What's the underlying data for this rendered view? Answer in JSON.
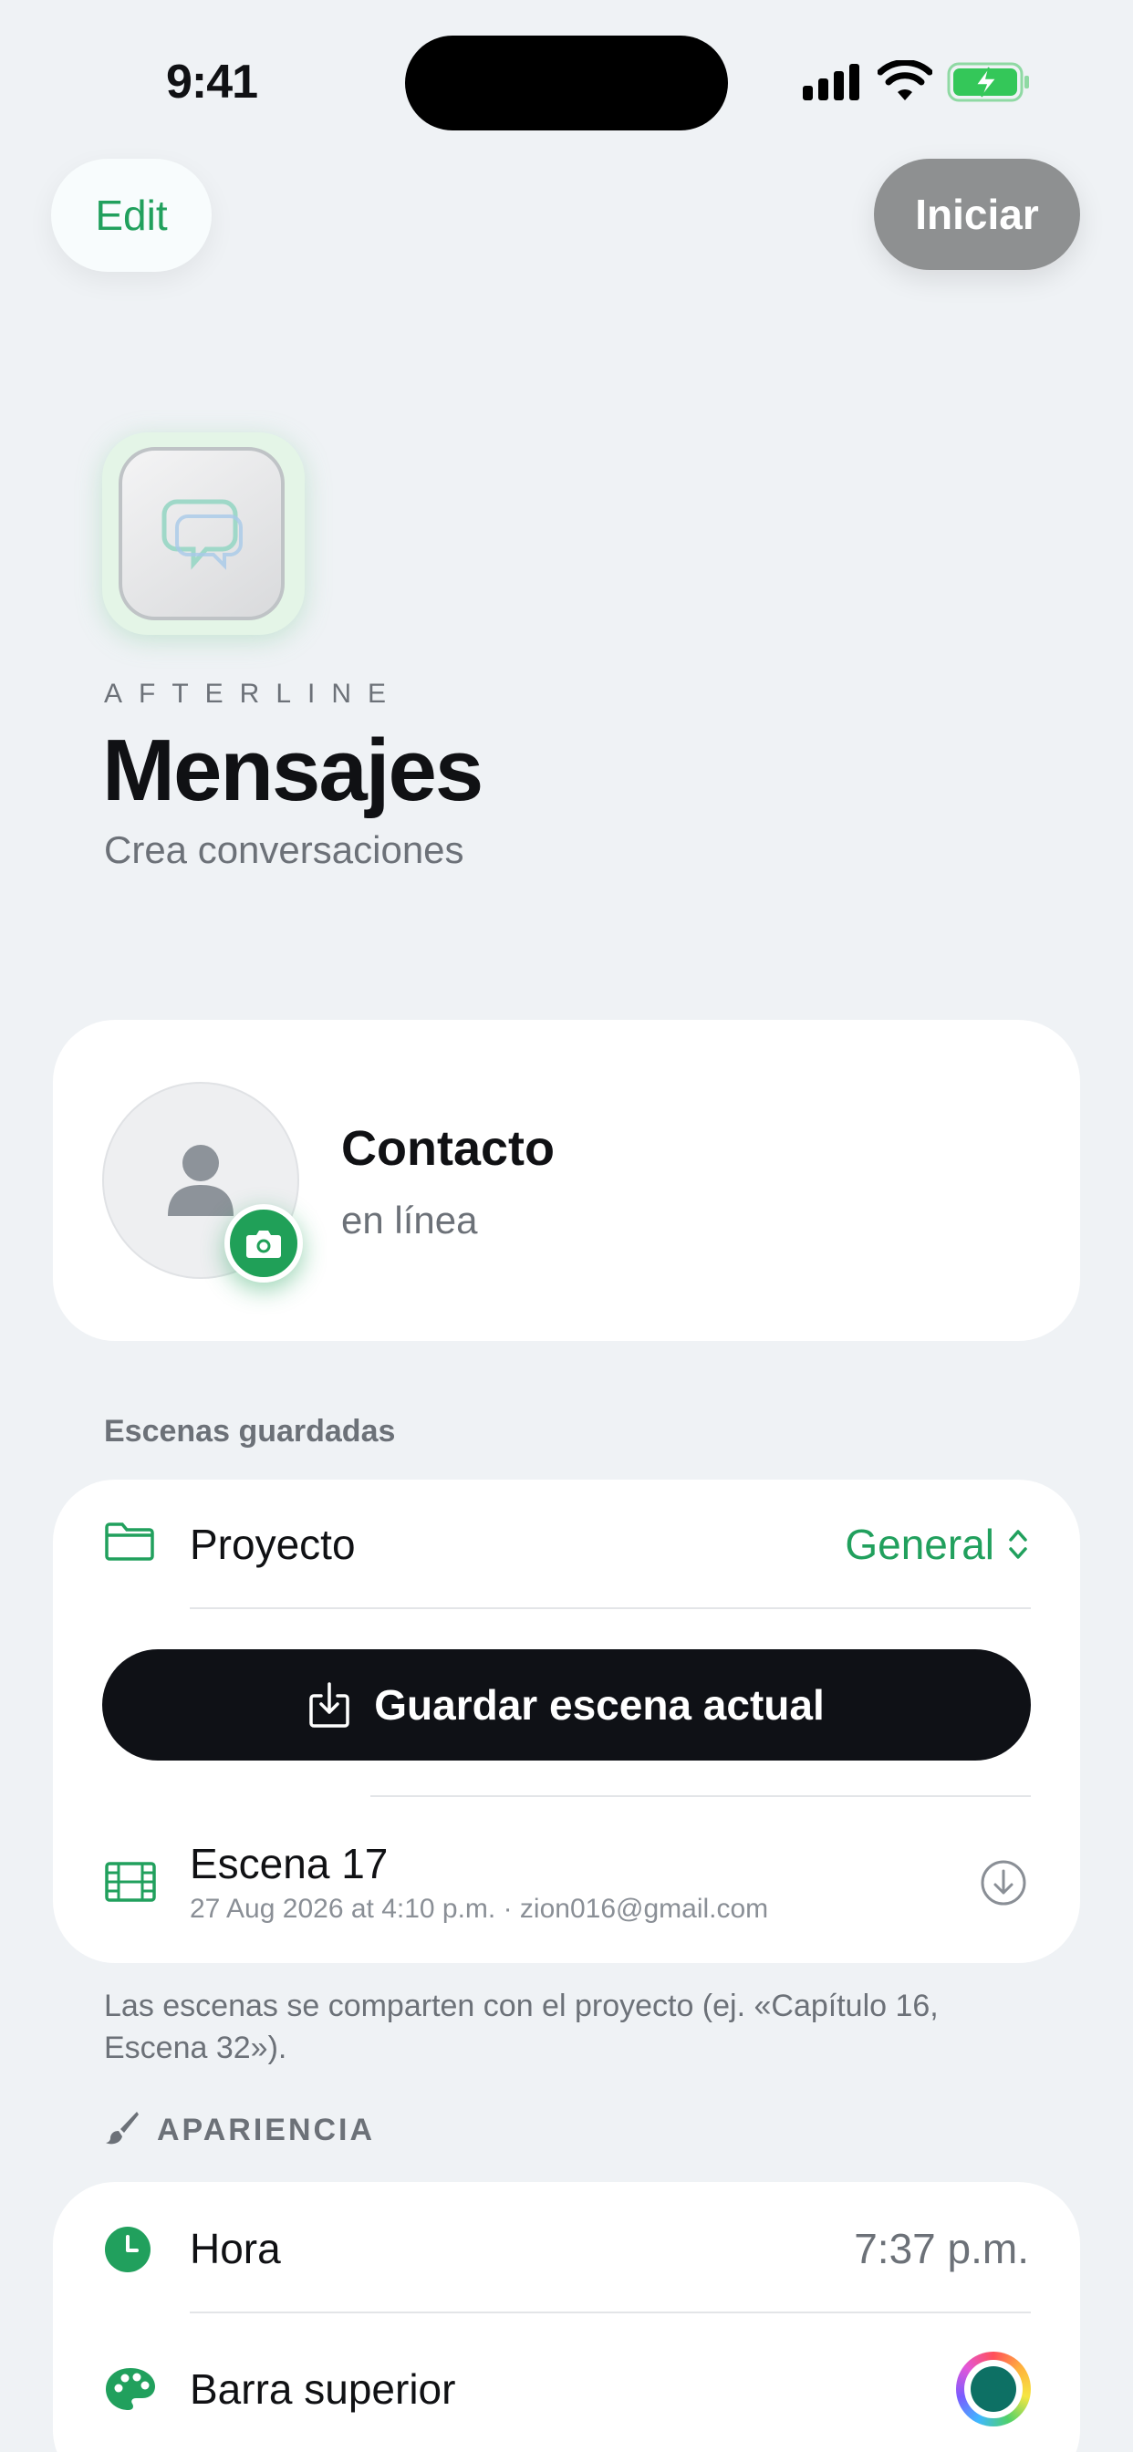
{
  "status_bar": {
    "time": "9:41",
    "icons": [
      "cellular-signal-icon",
      "wifi-icon",
      "battery-charging-icon"
    ]
  },
  "nav": {
    "edit_label": "Edit",
    "start_label": "Iniciar"
  },
  "app": {
    "brand": "AFTERLINE",
    "title": "Mensajes",
    "subtitle": "Crea conversaciones",
    "icon": "chat-bubble-icon"
  },
  "contact": {
    "name": "Contacto",
    "status": "en línea",
    "avatar_icon": "person-icon",
    "badge_icon": "camera-icon"
  },
  "saved_scenes": {
    "section_label": "Escenas guardadas",
    "project_label": "Proyecto",
    "project_value": "General",
    "save_button_label": "Guardar escena actual",
    "scene": {
      "title": "Escena 17",
      "meta": "27 Aug 2026 at 4:10 p.m. · zion016@gmail.com"
    },
    "note": "Las escenas se comparten con el proyecto (ej. «Capítulo 16, Escena 32»)."
  },
  "appearance": {
    "section_label": "APARIENCIA",
    "time_label": "Hora",
    "time_value": "7:37 p.m.",
    "top_bar_label": "Barra superior",
    "top_bar_color": "#0d7064"
  },
  "colors": {
    "accent": "#21a05d",
    "background": "#eff2f5",
    "primary_button": "#0f1116",
    "disabled_button": "#8e9091"
  }
}
